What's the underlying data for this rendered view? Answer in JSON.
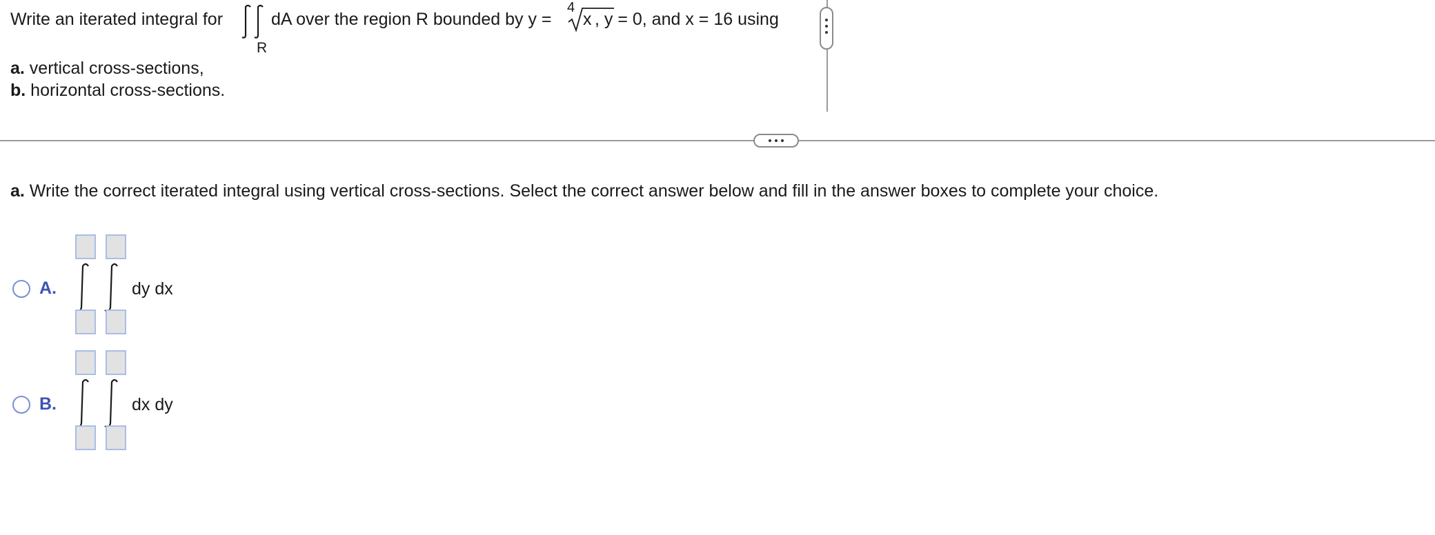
{
  "question": {
    "prefix": "Write an iterated integral for",
    "region_symbol": "R",
    "middle": "dA over the region R bounded by y =",
    "root_index": "4",
    "radicand": "x",
    "suffix": ", y = 0, and x = 16 using",
    "item_a_letter": "a.",
    "item_a_text": " vertical cross-sections,",
    "item_b_letter": "b.",
    "item_b_text": " horizontal cross-sections."
  },
  "part_a": {
    "letter": "a.",
    "text": " Write the correct iterated integral using vertical cross-sections. Select the correct answer below and fill in the answer boxes to complete your choice."
  },
  "options": [
    {
      "letter": "A.",
      "differentials": "dy dx"
    },
    {
      "letter": "B.",
      "differentials": "dx dy"
    }
  ],
  "colors": {
    "option_letter": "#3f51b5",
    "radio_border": "#7a8fd6",
    "answer_box_fill": "#e2e2e2",
    "answer_box_border": "#a9bde6"
  }
}
